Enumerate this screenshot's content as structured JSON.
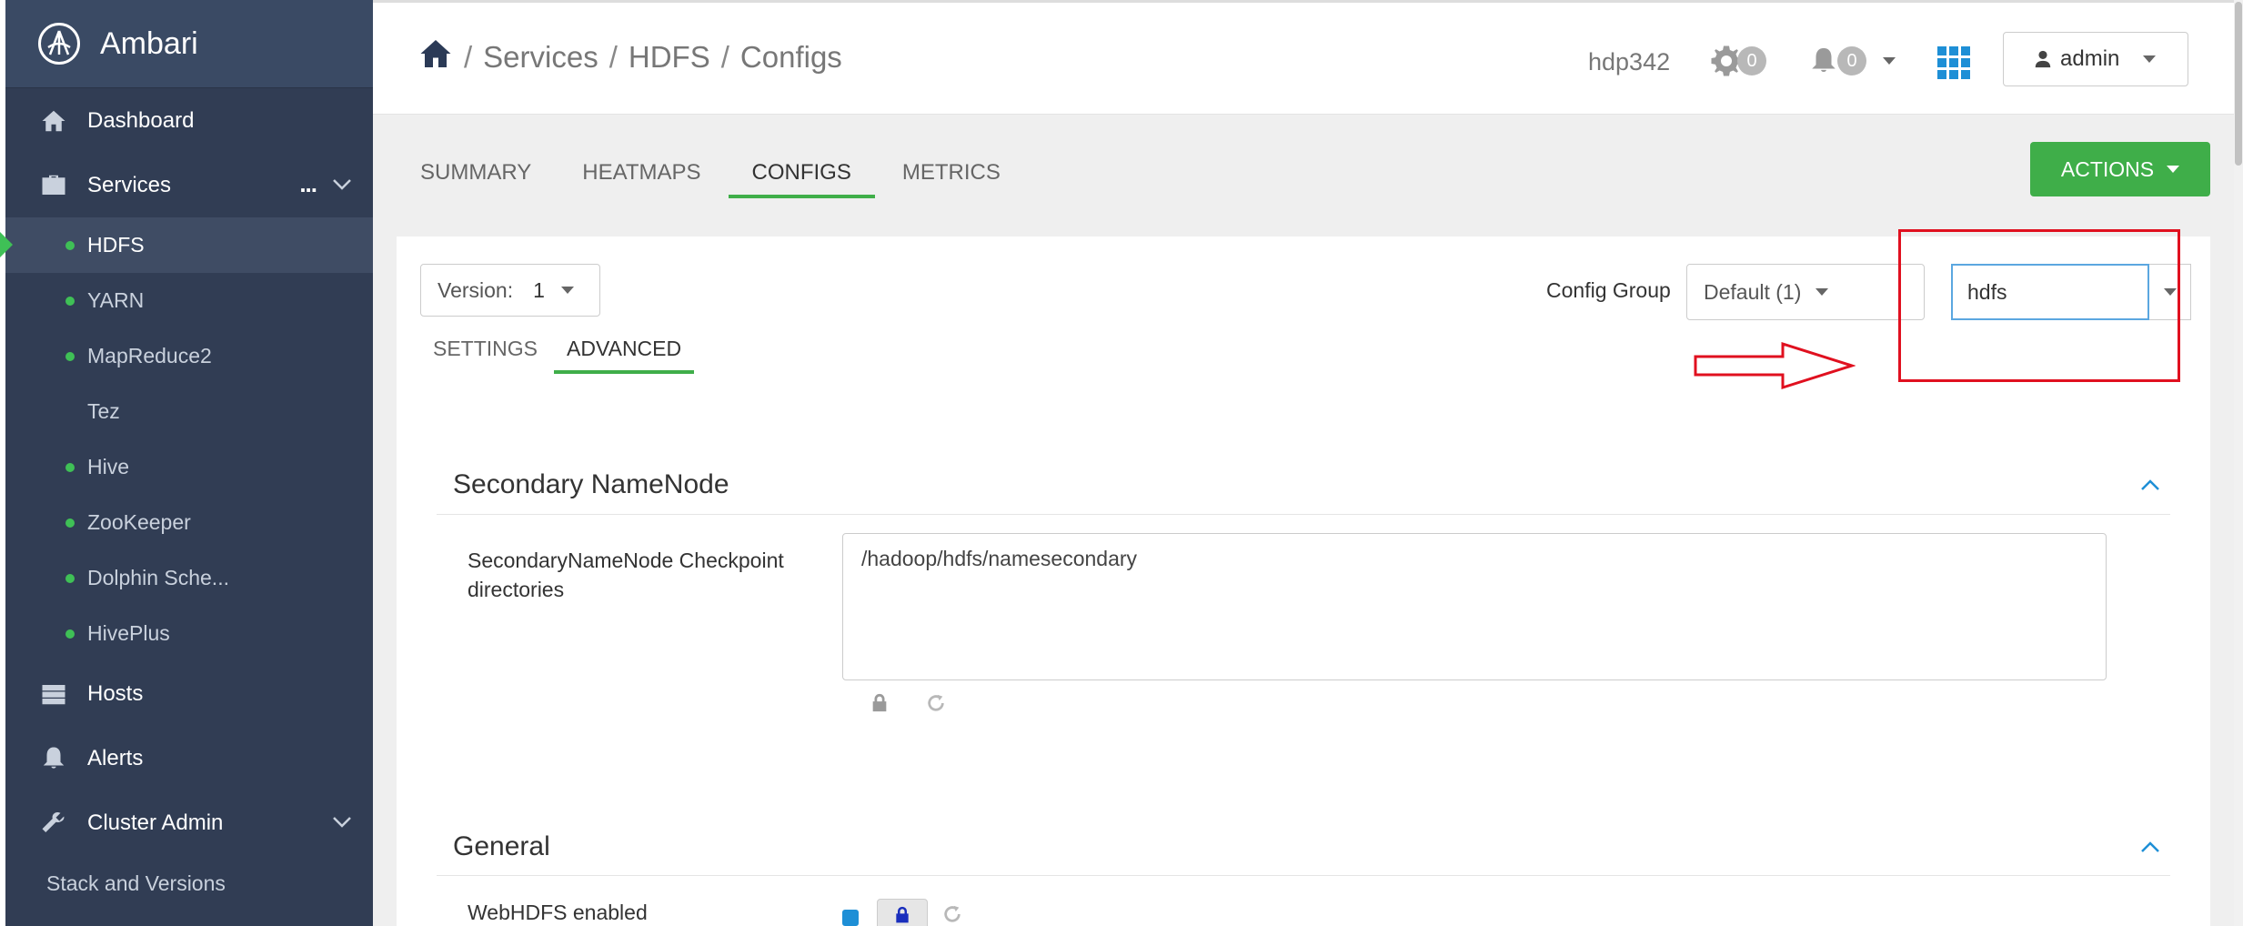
{
  "sidebar": {
    "brand": "Ambari",
    "items": [
      {
        "label": "Dashboard"
      },
      {
        "label": "Services"
      },
      {
        "label": "Hosts"
      },
      {
        "label": "Alerts"
      },
      {
        "label": "Cluster Admin"
      }
    ],
    "services": [
      {
        "label": "HDFS",
        "status": "started"
      },
      {
        "label": "YARN",
        "status": "started"
      },
      {
        "label": "MapReduce2",
        "status": "started"
      },
      {
        "label": "Tez",
        "status": "client-only"
      },
      {
        "label": "Hive",
        "status": "started"
      },
      {
        "label": "ZooKeeper",
        "status": "started"
      },
      {
        "label": "Dolphin Sche...",
        "status": "started"
      },
      {
        "label": "HivePlus",
        "status": "started"
      }
    ],
    "admin_sub": {
      "label": "Stack and Versions"
    },
    "more_label": "..."
  },
  "header": {
    "breadcrumb": [
      "Services",
      "HDFS",
      "Configs"
    ],
    "separator": "/",
    "cluster_name": "hdp342",
    "ops_count": "0",
    "alerts_count": "0",
    "user": "admin"
  },
  "tabs": [
    {
      "label": "SUMMARY"
    },
    {
      "label": "HEATMAPS"
    },
    {
      "label": "CONFIGS",
      "active": true
    },
    {
      "label": "METRICS"
    }
  ],
  "actions_label": "ACTIONS",
  "config": {
    "version_label": "Version:",
    "version_value": "1",
    "config_group_label": "Config Group",
    "config_group_value": "Default (1)",
    "filter_value": "hdfs",
    "subtabs": [
      {
        "label": "SETTINGS"
      },
      {
        "label": "ADVANCED",
        "active": true
      }
    ],
    "sections": [
      {
        "title": "Secondary NameNode",
        "fields": [
          {
            "label": "SecondaryNameNode Checkpoint directories",
            "value": "/hadoop/hdfs/namesecondary"
          }
        ]
      },
      {
        "title": "General",
        "fields": [
          {
            "label": "WebHDFS enabled",
            "checked": true
          }
        ]
      }
    ]
  },
  "colors": {
    "sidebar_bg": "#313d54",
    "accent_green": "#3fae49",
    "status_green": "#3fc056",
    "link_blue": "#1e8fd6",
    "annotation_red": "#e0101f"
  }
}
